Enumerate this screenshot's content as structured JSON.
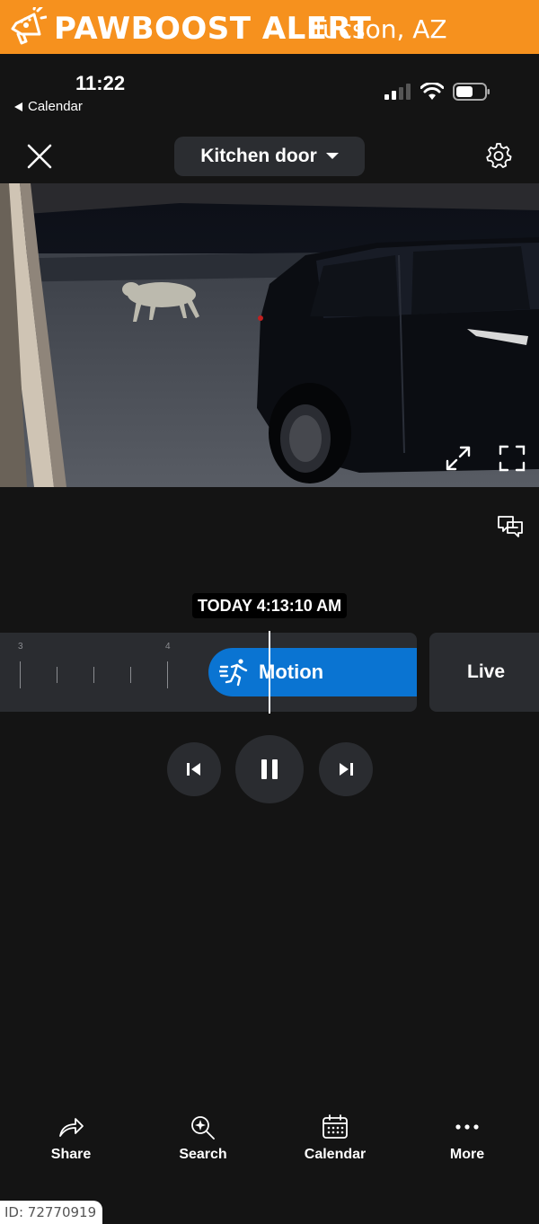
{
  "banner": {
    "brand": "PAWBOOST ALERT",
    "location": "Tucson, AZ",
    "color": "#f6911e",
    "icon": "megaphone-paw-icon"
  },
  "status_bar": {
    "time": "11:22",
    "back_label": "Calendar",
    "icons": [
      "cellular-signal-icon",
      "wifi-icon",
      "battery-icon"
    ]
  },
  "header": {
    "close_icon": "close-icon",
    "camera_name": "Kitchen door",
    "dropdown_icon": "caret-down-icon",
    "settings_icon": "gear-icon"
  },
  "video": {
    "controls": [
      "expand-icon",
      "fullscreen-icon"
    ]
  },
  "feedback": {
    "icon": "feedback-icon"
  },
  "timeline": {
    "timestamp": "TODAY 4:13:10 AM",
    "tick_labels": [
      "3",
      "4"
    ],
    "event_label": "Motion",
    "event_color": "#0a74d2",
    "live_label": "Live"
  },
  "playback": {
    "buttons": [
      "skip-previous-icon",
      "pause-icon",
      "skip-next-icon"
    ]
  },
  "bottom_nav": {
    "items": [
      {
        "label": "Share",
        "icon": "share-icon"
      },
      {
        "label": "Search",
        "icon": "search-sparkle-icon"
      },
      {
        "label": "Calendar",
        "icon": "calendar-icon"
      },
      {
        "label": "More",
        "icon": "more-icon"
      }
    ]
  },
  "footer": {
    "id_text": "ID: 72770919"
  }
}
